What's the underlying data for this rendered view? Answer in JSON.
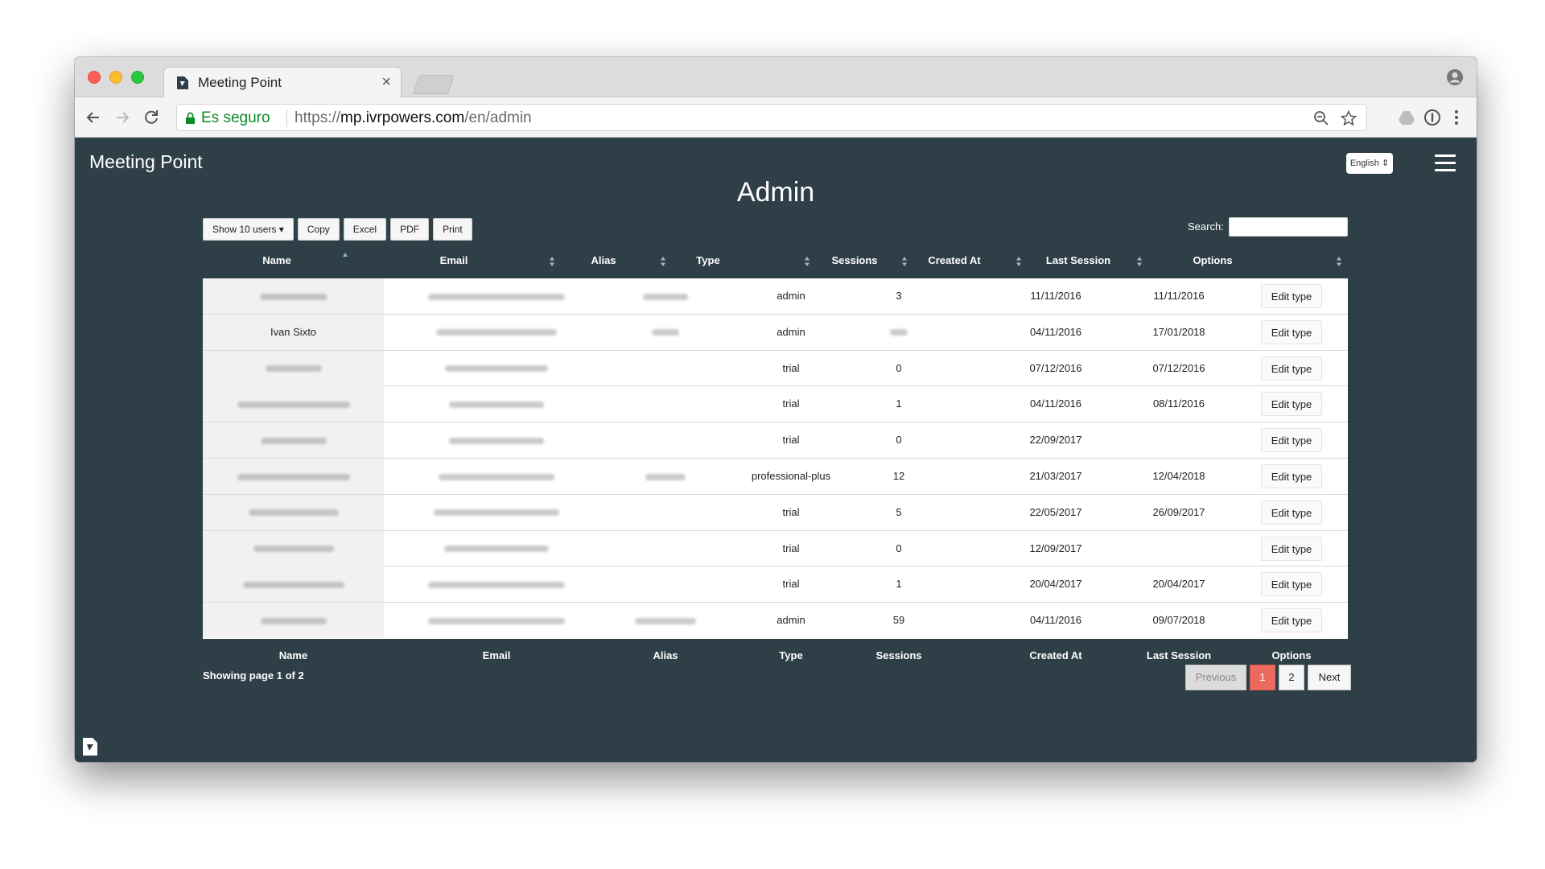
{
  "browser": {
    "tab_title": "Meeting Point",
    "tab_close": "×",
    "secure_label": "Es seguro",
    "url_scheme": "https://",
    "url_host": "mp.ivrpowers.com",
    "url_path": "/en/admin"
  },
  "app": {
    "brand": "Meeting Point",
    "language": "English",
    "page_title": "Admin"
  },
  "controls": {
    "show_users": "Show 10 users ▾",
    "copy": "Copy",
    "excel": "Excel",
    "pdf": "PDF",
    "print": "Print",
    "search_label": "Search:"
  },
  "table": {
    "columns": [
      "Name",
      "Email",
      "Alias",
      "Type",
      "Sessions",
      "Created At",
      "Last Session",
      "Options"
    ],
    "rows": [
      {
        "name": "",
        "type": "admin",
        "sessions": "3",
        "created": "11/11/2016",
        "last": "11/11/2016",
        "option": "Edit type"
      },
      {
        "name": "Ivan Sixto",
        "type": "admin",
        "sessions": "",
        "created": "04/11/2016",
        "last": "17/01/2018",
        "option": "Edit type"
      },
      {
        "name": "",
        "type": "trial",
        "sessions": "0",
        "created": "07/12/2016",
        "last": "07/12/2016",
        "option": "Edit type"
      },
      {
        "name": "",
        "type": "trial",
        "sessions": "1",
        "created": "04/11/2016",
        "last": "08/11/2016",
        "option": "Edit type"
      },
      {
        "name": "",
        "type": "trial",
        "sessions": "0",
        "created": "22/09/2017",
        "last": "",
        "option": "Edit type"
      },
      {
        "name": "",
        "type": "professional-plus",
        "sessions": "12",
        "created": "21/03/2017",
        "last": "12/04/2018",
        "option": "Edit type"
      },
      {
        "name": "",
        "type": "trial",
        "sessions": "5",
        "created": "22/05/2017",
        "last": "26/09/2017",
        "option": "Edit type"
      },
      {
        "name": "",
        "type": "trial",
        "sessions": "0",
        "created": "12/09/2017",
        "last": "",
        "option": "Edit type"
      },
      {
        "name": "",
        "type": "trial",
        "sessions": "1",
        "created": "20/04/2017",
        "last": "20/04/2017",
        "option": "Edit type"
      },
      {
        "name": "",
        "type": "admin",
        "sessions": "59",
        "created": "04/11/2016",
        "last": "09/07/2018",
        "option": "Edit type"
      }
    ]
  },
  "pagination": {
    "info": "Showing page 1 of 2",
    "previous": "Previous",
    "page1": "1",
    "page2": "2",
    "next": "Next"
  },
  "colors": {
    "page_background": "#2f3f48",
    "active_page": "#ec6a5e",
    "secure_green": "#0a8a2a"
  }
}
